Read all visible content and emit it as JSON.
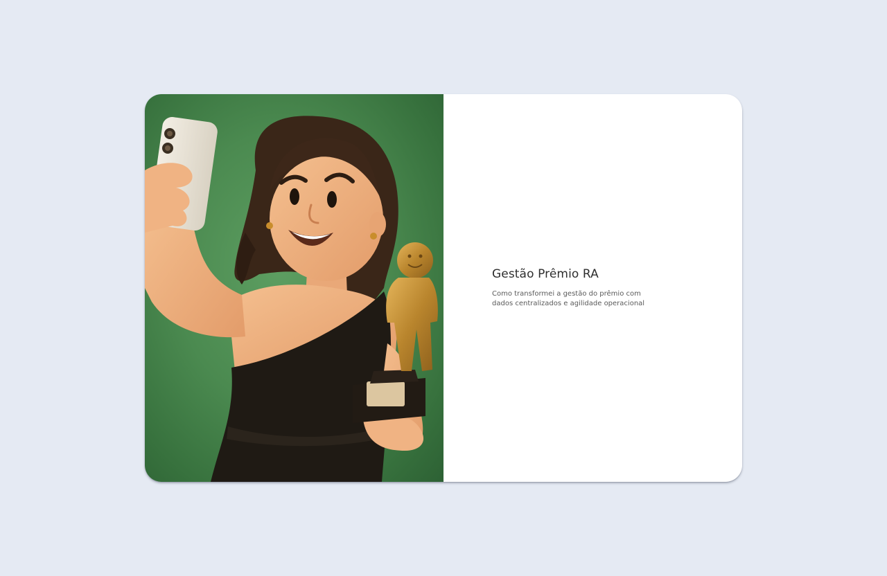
{
  "card": {
    "title": "Gestão Prêmio RA",
    "subtitle": "Como transformei a gestão do prêmio com dados centralizados e agilidade operacional"
  },
  "illustration": {
    "icons": [
      "woman-selfie-illustration",
      "smartphone-icon",
      "trophy-icon"
    ]
  },
  "colors": {
    "page_background": "#e5eaf3",
    "card_background": "#ffffff",
    "hero_green": "#4b8a50",
    "dress": "#1f1a14",
    "trophy_gold": "#b8862e"
  }
}
